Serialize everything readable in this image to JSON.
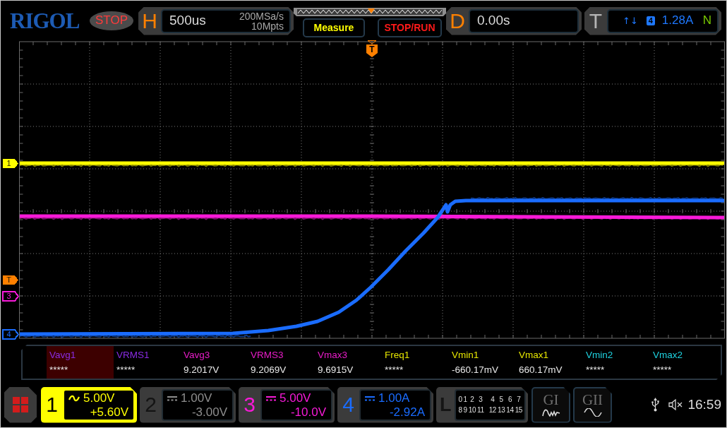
{
  "header": {
    "logo": "RIGOL",
    "run_status": "STOP",
    "horizontal": {
      "label": "H",
      "timebase": "500us",
      "sample_rate": "200MSa/s",
      "memory_depth": "10Mpts"
    },
    "buttons": [
      {
        "label": "Measure",
        "color": "#ffff00"
      },
      {
        "label": "STOP/RUN",
        "color": "#ff1a1a"
      }
    ],
    "delay": {
      "label": "D",
      "value": "0.00s"
    },
    "trigger": {
      "label": "T",
      "slope": "↑↓",
      "source": "4",
      "level": "1.28A",
      "sweep": "N"
    }
  },
  "display": {
    "trigger_position_marker": "T",
    "markers": [
      {
        "label": "1",
        "color": "#ffff00",
        "kind": "filled"
      },
      {
        "label": "T",
        "color": "#ff8000",
        "kind": "filled"
      },
      {
        "label": "3",
        "color": "#f81ad8",
        "kind": "outline"
      },
      {
        "label": "4",
        "color": "#1a6cff",
        "kind": "outline"
      }
    ]
  },
  "measurements": [
    {
      "label": "Vavg1",
      "value": "*****",
      "color": "#8a2be2",
      "selected": true
    },
    {
      "label": "VRMS1",
      "value": "*****",
      "color": "#8a2be2",
      "selected": false
    },
    {
      "label": "Vavg3",
      "value": "9.2017V",
      "color": "#e81cc8",
      "selected": false
    },
    {
      "label": "VRMS3",
      "value": "9.2069V",
      "color": "#e81cc8",
      "selected": false
    },
    {
      "label": "Vmax3",
      "value": "9.6915V",
      "color": "#e81cc8",
      "selected": false
    },
    {
      "label": "Freq1",
      "value": "*****",
      "color": "#e6e600",
      "selected": false
    },
    {
      "label": "Vmin1",
      "value": "-660.17mV",
      "color": "#e6e600",
      "selected": false
    },
    {
      "label": "Vmax1",
      "value": "660.17mV",
      "color": "#e6e600",
      "selected": false
    },
    {
      "label": "Vmin2",
      "value": "*****",
      "color": "#1ed2e0",
      "selected": false
    },
    {
      "label": "Vmax2",
      "value": "*****",
      "color": "#1ed2e0",
      "selected": false
    }
  ],
  "channels": [
    {
      "label": "1",
      "ac_coupling": true,
      "scale": "5.00V",
      "offset": "+5.60V",
      "color": "#ffff00",
      "on": true,
      "selected": true
    },
    {
      "label": "2",
      "ac_coupling": false,
      "scale": "1.00V",
      "offset": "-3.00V",
      "on": false,
      "selected": false
    },
    {
      "label": "3",
      "ac_coupling": false,
      "scale": "5.00V",
      "offset": "-10.0V",
      "color": "#f81ad8",
      "on": true,
      "selected": false
    },
    {
      "label": "4",
      "ac_coupling": false,
      "scale": "1.00A",
      "offset": "-2.92A",
      "color": "#1a6cff",
      "on": true,
      "selected": false
    }
  ],
  "logic": {
    "label": "L",
    "bits": [
      "0",
      "1",
      "2",
      "3",
      "4",
      "5",
      "6",
      "7",
      "8",
      "9",
      "10",
      "11",
      "12",
      "13",
      "14",
      "15"
    ]
  },
  "generators": [
    {
      "label": "GI",
      "kind": "arbitrary"
    },
    {
      "label": "GII",
      "kind": "sine"
    }
  ],
  "status": {
    "sound_muted": true,
    "time": "16:59"
  }
}
